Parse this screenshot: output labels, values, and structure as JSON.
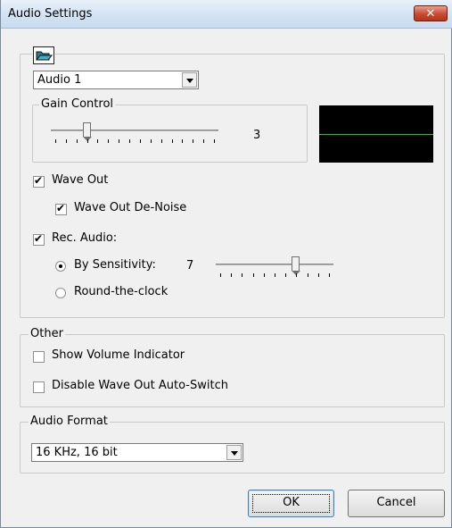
{
  "window": {
    "title": "Audio Settings",
    "close_glyph": "✕"
  },
  "audio": {
    "source": "Audio 1",
    "gain_label": "Gain Control",
    "gain_value": "3",
    "gain_level": 3,
    "gain_max": 15,
    "wave_out": {
      "label": "Wave Out",
      "checked": true
    },
    "wave_out_denoise": {
      "label": "Wave Out De-Noise",
      "checked": true
    },
    "rec_audio": {
      "label": "Rec. Audio:",
      "checked": true
    },
    "by_sensitivity": {
      "label": "By Sensitivity:",
      "selected": true
    },
    "sensitivity_value": "7",
    "sensitivity_level": 7,
    "sensitivity_max": 10,
    "round_clock": {
      "label": "Round-the-clock",
      "selected": false
    }
  },
  "other": {
    "label": "Other",
    "show_volume": {
      "label": "Show Volume Indicator",
      "checked": false
    },
    "disable_switch": {
      "label": "Disable Wave Out Auto-Switch",
      "checked": false
    }
  },
  "format": {
    "label": "Audio Format",
    "value": "16 KHz, 16 bit"
  },
  "buttons": {
    "ok": "OK",
    "cancel": "Cancel"
  },
  "colors": {
    "meter_bg": "#000000",
    "meter_line": "#1fc81f"
  },
  "icons": {
    "header": "folder-open-icon",
    "close": "close-icon"
  }
}
